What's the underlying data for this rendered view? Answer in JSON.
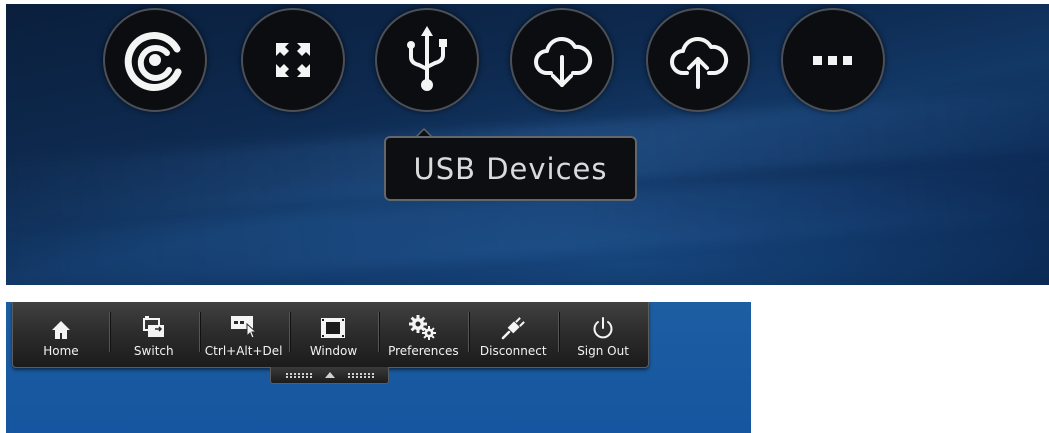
{
  "top_toolbar": {
    "buttons": [
      {
        "id": "connection",
        "icon": "connection-strength-icon"
      },
      {
        "id": "fullscreen",
        "icon": "fullscreen-icon"
      },
      {
        "id": "usb",
        "icon": "usb-icon"
      },
      {
        "id": "download",
        "icon": "cloud-download-icon"
      },
      {
        "id": "upload",
        "icon": "cloud-upload-icon"
      },
      {
        "id": "more",
        "icon": "more-icon"
      }
    ],
    "tooltip": "USB Devices"
  },
  "session_toolbar": {
    "items": [
      {
        "label": "Home",
        "icon": "home-icon"
      },
      {
        "label": "Switch",
        "icon": "switch-icon"
      },
      {
        "label": "Ctrl+Alt+Del",
        "icon": "ctrl-alt-del-icon"
      },
      {
        "label": "Window",
        "icon": "window-icon"
      },
      {
        "label": "Preferences",
        "icon": "gears-icon"
      },
      {
        "label": "Disconnect",
        "icon": "plug-icon"
      },
      {
        "label": "Sign Out",
        "icon": "power-icon"
      }
    ],
    "handle_icon": "collapse-handle-icon"
  },
  "colors": {
    "button_bg": "#0b0d10",
    "icon_white": "#f4f4f4",
    "desktop_blue": "#1a5aa0",
    "tooltip_text": "#d9dadb"
  }
}
